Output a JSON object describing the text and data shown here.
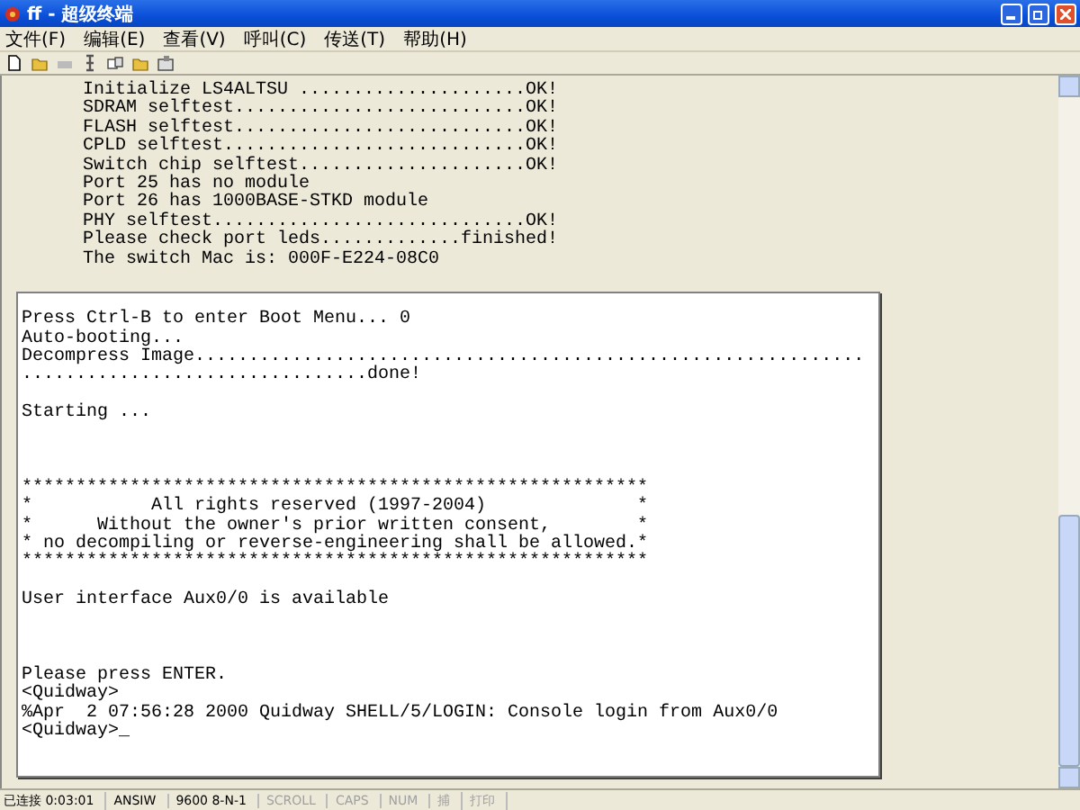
{
  "window": {
    "title": "ff - 超级终端"
  },
  "menu": [
    "文件(F)",
    "编辑(E)",
    "查看(V)",
    "呼叫(C)",
    "传送(T)",
    "帮助(H)"
  ],
  "terminal": {
    "history_lines": [
      "Initialize LS4ALTSU .....................OK!",
      "SDRAM selftest...........................OK!",
      "FLASH selftest...........................OK!",
      "CPLD selftest............................OK!",
      "Switch chip selftest.....................OK!",
      "Port 25 has no module",
      "Port 26 has 1000BASE-STKD module",
      "PHY selftest.............................OK!",
      "Please check port leds.............finished!",
      "The switch Mac is: 000F-E224-08C0"
    ],
    "screen_blocks": [
      [
        "Press Ctrl-B to enter Boot Menu... 0",
        "Auto-booting...",
        "Decompress Image..............................................................",
        "................................done!"
      ],
      [
        "Starting ..."
      ],
      [
        "**********************************************************",
        "*           All rights reserved (1997-2004)              *",
        "*      Without the owner's prior written consent,        *",
        "* no decompiling or reverse-engineering shall be allowed.*",
        "**********************************************************"
      ],
      [
        "User interface Aux0/0 is available"
      ],
      [
        "Please press ENTER.",
        "<Quidway>",
        "%Apr  2 07:56:28 2000 Quidway SHELL/5/LOGIN: Console login from Aux0/0",
        "<Quidway>_"
      ]
    ]
  },
  "status_bar": [
    {
      "text": "已连接 0:03:01",
      "disabled": false
    },
    {
      "text": "ANSIW",
      "disabled": false
    },
    {
      "text": "9600 8-N-1",
      "disabled": false
    },
    {
      "text": "SCROLL",
      "disabled": true
    },
    {
      "text": "CAPS",
      "disabled": true
    },
    {
      "text": "NUM",
      "disabled": true
    },
    {
      "text": "捕",
      "disabled": true
    },
    {
      "text": "打印",
      "disabled": true
    }
  ]
}
